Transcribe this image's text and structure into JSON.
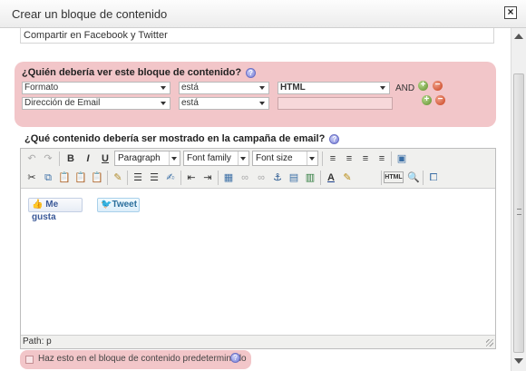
{
  "dialog": {
    "title": "Crear un bloque de contenido",
    "close_icon": "close-icon"
  },
  "content_strip_text": "Compartir en Facebook y Twitter",
  "audience": {
    "title": "¿Quién debería ver este bloque de contenido?",
    "rows": [
      {
        "field": "Formato",
        "operator": "está",
        "value": "HTML",
        "joiner": "AND"
      },
      {
        "field": "Dirección de Email",
        "operator": "está",
        "value": ""
      }
    ]
  },
  "content": {
    "title": "¿Qué contenido debería ser mostrado en la campaña de email?",
    "toolbar": {
      "format_select": "Paragraph",
      "font_family_select": "Font family",
      "font_size_select": "Font size",
      "bold": "B",
      "italic": "I",
      "underline": "U",
      "html_button": "HTML"
    },
    "like_button": "Me gusta",
    "tweet_button": "Tweet",
    "path_label": "Path: p"
  },
  "default_checkbox": {
    "label": "Haz esto en el bloque de contenido predeterminado",
    "checked": false
  },
  "colors": {
    "highlight": "#f2c6c9",
    "add": "#5d8c2a",
    "remove": "#c9411c"
  }
}
